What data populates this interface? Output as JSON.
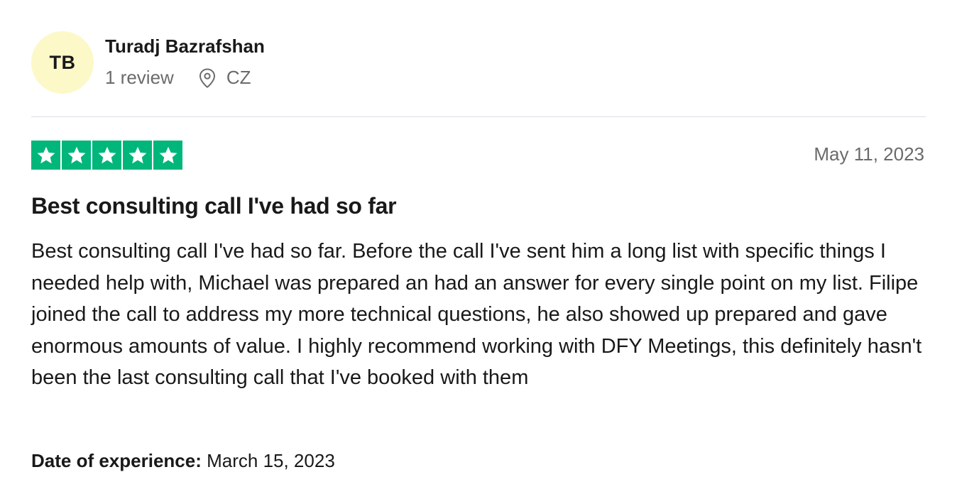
{
  "reviewer": {
    "initials": "TB",
    "avatar_color": "#fcf8c8",
    "name": "Turadj Bazrafshan",
    "review_count": "1 review",
    "location": "CZ",
    "location_icon": "map-pin-icon"
  },
  "review": {
    "rating": 5,
    "max_rating": 5,
    "star_color": "#00b67a",
    "date": "May 11, 2023",
    "title": "Best consulting call I've had so far",
    "body": "Best consulting call I've had so far. Before the call I've sent him a long list with specific things I needed help with, Michael was prepared an had an answer for every single point on my list. Filipe joined the call to address my more technical questions, he also showed up prepared and gave enormous amounts of value. I highly recommend working with DFY Meetings, this definitely hasn't been the last consulting call that I've booked with them",
    "experience_label": "Date of experience:",
    "experience_date": "March 15, 2023"
  }
}
